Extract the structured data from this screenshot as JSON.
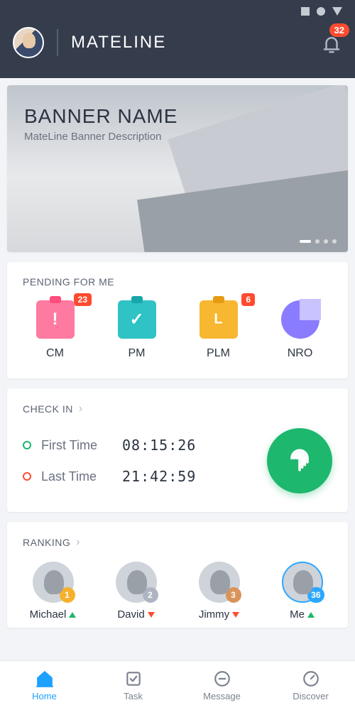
{
  "header": {
    "title": "MATELINE",
    "notification_count": "32"
  },
  "banner": {
    "title": "BANNER NAME",
    "subtitle": "MateLine Banner Description"
  },
  "pending": {
    "title": "PENDING FOR ME",
    "items": [
      {
        "label": "CM",
        "badge": "23"
      },
      {
        "label": "PM",
        "badge": ""
      },
      {
        "label": "PLM",
        "badge": "6"
      },
      {
        "label": "NRO",
        "badge": ""
      }
    ]
  },
  "checkin": {
    "title": "CHECK IN",
    "first_label": "First Time",
    "first_value": "08:15:26",
    "last_label": "Last Time",
    "last_value": "21:42:59"
  },
  "ranking": {
    "title": "RANKING",
    "items": [
      {
        "name": "Michael",
        "rank": "1",
        "trend": "up"
      },
      {
        "name": "David",
        "rank": "2",
        "trend": "down"
      },
      {
        "name": "Jimmy",
        "rank": "3",
        "trend": "down"
      },
      {
        "name": "Me",
        "rank": "36",
        "trend": "up"
      }
    ]
  },
  "nav": {
    "home": "Home",
    "task": "Task",
    "message": "Message",
    "discover": "Discover"
  }
}
